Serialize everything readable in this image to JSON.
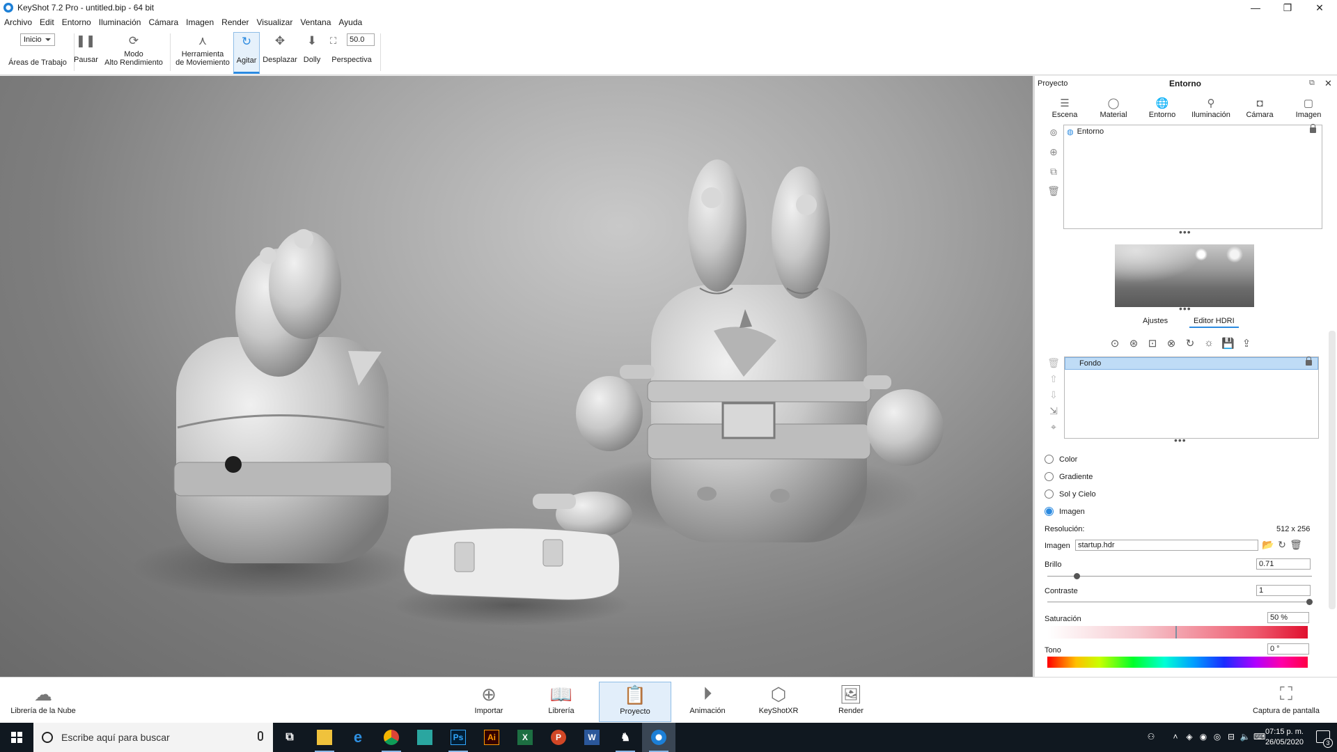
{
  "window": {
    "title": "KeyShot 7.2 Pro  - untitled.bip  - 64 bit",
    "controls": [
      "—",
      "❐",
      "✕"
    ]
  },
  "menu": [
    "Archivo",
    "Edit",
    "Entorno",
    "Iluminación",
    "Cámara",
    "Imagen",
    "Render",
    "Visualizar",
    "Ventana",
    "Ayuda"
  ],
  "toolbar": {
    "workspace_value": "Inicio",
    "workspace_label": "Áreas de Trabajo",
    "pause": "Pausar",
    "perf_mode_line1": "Modo",
    "perf_mode_line2": "Alto Rendimiento",
    "motion_tool_line1": "Herramienta",
    "motion_tool_line2": "de Moviemiento",
    "tumble": "Agitar",
    "pan": "Desplazar",
    "dolly": "Dolly",
    "fov_value": "50.0",
    "perspective": "Perspectiva"
  },
  "panel": {
    "header_left": "Proyecto",
    "header_title": "Entorno",
    "tabs": [
      "Escena",
      "Material",
      "Entorno",
      "Iluminación",
      "Cámara",
      "Imagen"
    ],
    "active_tab": "Entorno",
    "env_list_item": "Entorno",
    "subtabs": [
      "Ajustes",
      "Editor HDRI"
    ],
    "active_subtab": "Editor HDRI",
    "pin_list_item": "Fondo",
    "background_options": [
      "Color",
      "Gradiente",
      "Sol y Cielo",
      "Imagen"
    ],
    "selected_background": "Imagen",
    "resolution_label": "Resolución:",
    "resolution_value": "512 x 256",
    "image_label": "Imagen",
    "image_value": "startup.hdr",
    "brightness_label": "Brillo",
    "brightness_value": "0.71",
    "brightness_level": 0.11,
    "contrast_label": "Contraste",
    "contrast_value": "1",
    "contrast_level": 1.0,
    "saturation_label": "Saturación",
    "saturation_value": "50 %",
    "hue_label": "Tono",
    "hue_value": "0 °"
  },
  "ribbon": {
    "cloud_library": "Librería de la Nube",
    "buttons": [
      "Importar",
      "Librería",
      "Proyecto",
      "Animación",
      "KeyShotXR",
      "Render"
    ],
    "active": "Proyecto",
    "screenshot": "Captura de pantalla"
  },
  "taskbar": {
    "search_placeholder": "Escribe aquí para buscar",
    "time": "07:15 p. m.",
    "date": "26/05/2020",
    "notifications": "3"
  }
}
